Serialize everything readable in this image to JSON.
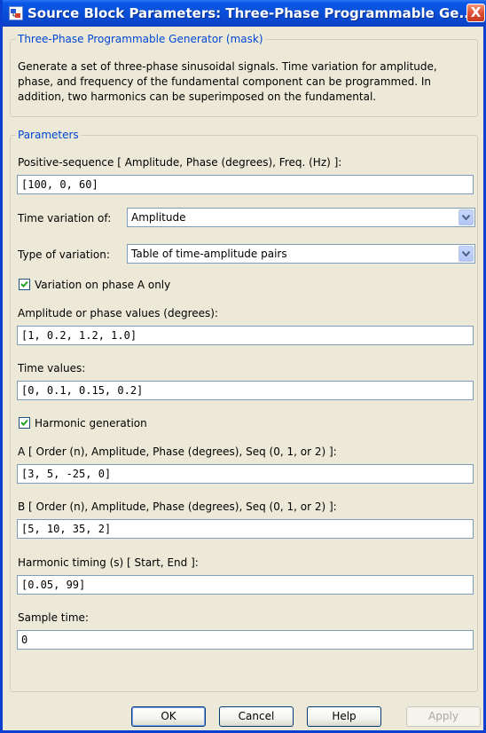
{
  "window": {
    "title": "Source Block Parameters: Three-Phase Programmable Ge...",
    "close_label": "X"
  },
  "mask": {
    "legend": "Three-Phase Programmable Generator (mask)",
    "description_lines": [
      "Generate a set of three-phase sinusoidal signals. Time variation for amplitude,",
      "phase, and frequency of the fundamental component can be programmed. In",
      "addition, two harmonics can be superimposed on the fundamental."
    ]
  },
  "parameters": {
    "legend": "Parameters",
    "positive_sequence_label": "Positive-sequence [ Amplitude, Phase (degrees), Freq. (Hz) ]:",
    "positive_sequence_value": "[100, 0, 60]",
    "time_variation_label": "Time variation of:",
    "time_variation_value": "Amplitude",
    "type_variation_label": "Type of variation:",
    "type_variation_value": "Table of time-amplitude pairs",
    "phase_a_only_label": "Variation on phase A only",
    "phase_a_only_checked": true,
    "amp_phase_values_label": "Amplitude or phase values (degrees):",
    "amp_phase_values_value": "[1, 0.2, 1.2, 1.0]",
    "time_values_label": "Time values:",
    "time_values_value": "[0, 0.1, 0.15, 0.2]",
    "harmonic_generation_label": "Harmonic generation",
    "harmonic_generation_checked": true,
    "harmonic_a_label": "A  [ Order (n), Amplitude, Phase (degrees), Seq (0, 1, or 2) ]:",
    "harmonic_a_value": "[3,  5,  -25, 0]",
    "harmonic_b_label": "B  [ Order (n), Amplitude, Phase (degrees), Seq (0, 1, or 2) ]:",
    "harmonic_b_value": "[5,  10,  35, 2]",
    "harmonic_timing_label": "Harmonic timing (s) [ Start, End ]:",
    "harmonic_timing_value": "[0.05,  99]",
    "sample_time_label": "Sample time:",
    "sample_time_value": "0"
  },
  "buttons": {
    "ok": "OK",
    "cancel": "Cancel",
    "help": "Help",
    "apply": "Apply"
  },
  "colors": {
    "title_bar": "#0a4ed8",
    "legend_text": "#0046d5",
    "dialog_background": "#ece9d8"
  }
}
